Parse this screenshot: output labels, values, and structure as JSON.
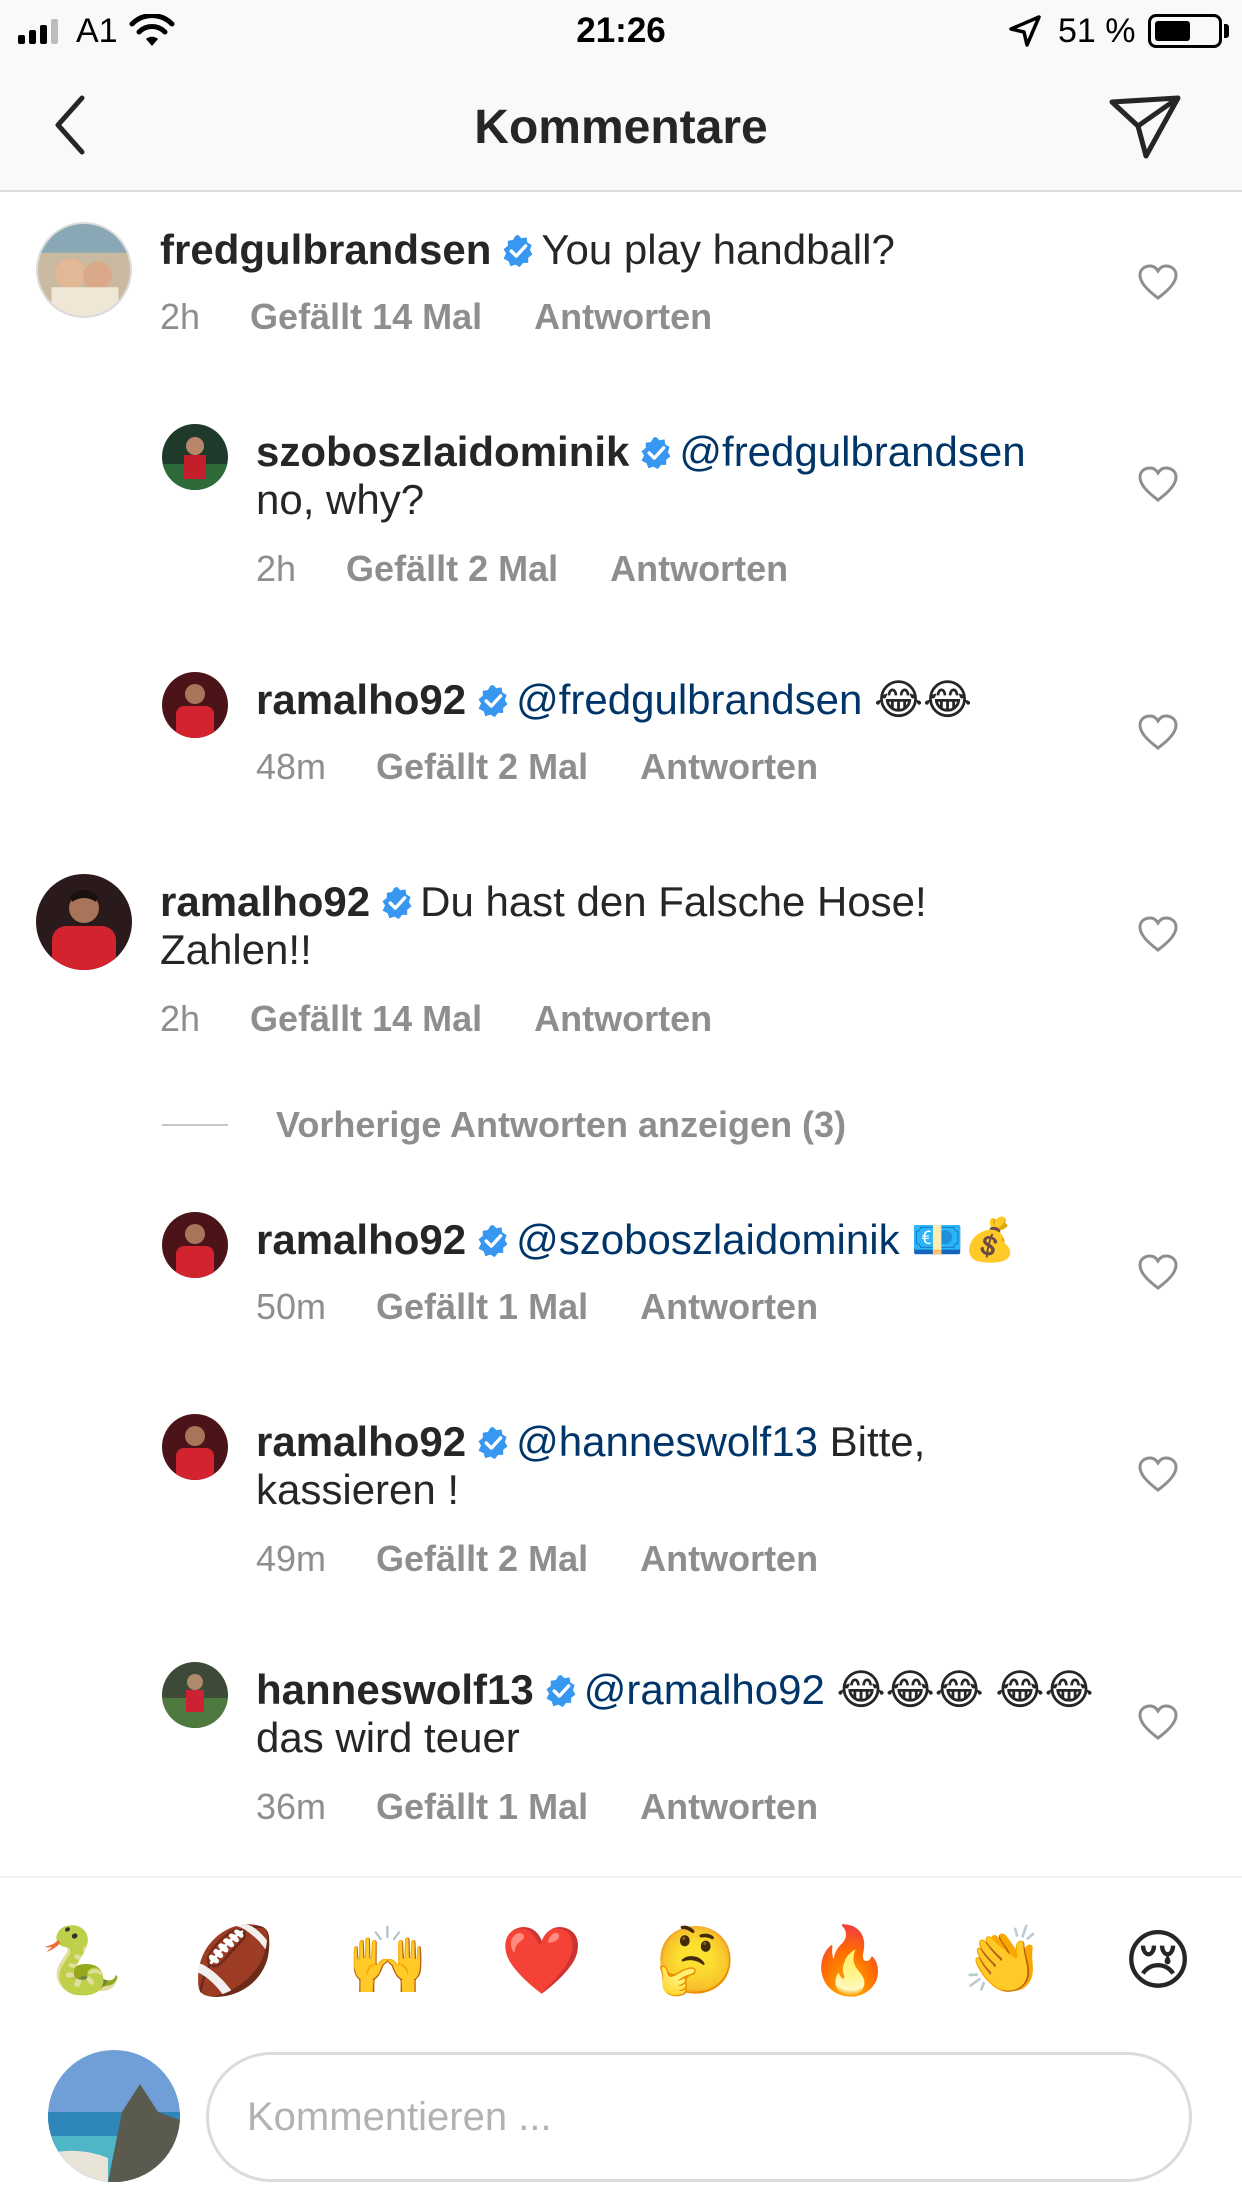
{
  "status_bar": {
    "carrier": "A1",
    "time": "21:26",
    "battery_percent": "51 %",
    "battery_level": 0.51,
    "signal_bars_filled": 3,
    "signal_bars_total": 4
  },
  "header": {
    "title": "Kommentare",
    "back_icon": "chevron-left-icon",
    "send_icon": "paper-plane-icon"
  },
  "comments": [
    {
      "username": "fredgulbrandsen",
      "verified": true,
      "mention": "",
      "text": "You play handball?",
      "time": "2h",
      "likes": "Gefällt 14 Mal",
      "reply": "Antworten",
      "indent": false
    },
    {
      "username": "szoboszlaidominik",
      "verified": true,
      "mention": "@fredgulbrandsen",
      "text": "no, why?",
      "time": "2h",
      "likes": "Gefällt 2 Mal",
      "reply": "Antworten",
      "indent": true
    },
    {
      "username": "ramalho92",
      "verified": true,
      "mention": "@fredgulbrandsen",
      "text": "😂😂",
      "time": "48m",
      "likes": "Gefällt 2 Mal",
      "reply": "Antworten",
      "indent": true
    },
    {
      "username": "ramalho92",
      "verified": true,
      "mention": "",
      "text": "Du hast den Falsche Hose! Zahlen!!",
      "time": "2h",
      "likes": "Gefällt 14 Mal",
      "reply": "Antworten",
      "indent": false
    },
    {
      "username": "ramalho92",
      "verified": true,
      "mention": "@szoboszlaidominik",
      "text": "💶💰",
      "time": "50m",
      "likes": "Gefällt 1 Mal",
      "reply": "Antworten",
      "indent": true
    },
    {
      "username": "ramalho92",
      "verified": true,
      "mention": "@hanneswolf13",
      "text": "Bitte, kassieren !",
      "time": "49m",
      "likes": "Gefällt 2 Mal",
      "reply": "Antworten",
      "indent": true
    },
    {
      "username": "hanneswolf13",
      "verified": true,
      "mention": "@ramalho92",
      "text": "😂😂😂 😂😂 das wird teuer",
      "time": "36m",
      "likes": "Gefällt 1 Mal",
      "reply": "Antworten",
      "indent": true
    }
  ],
  "view_previous": "Vorherige Antworten anzeigen (3)",
  "quick_emojis": [
    "🐍",
    "🏈",
    "🙌",
    "❤️",
    "🤔",
    "🔥",
    "👏",
    "😢"
  ],
  "composer": {
    "placeholder": "Kommentieren ..."
  },
  "colors": {
    "text": "#262626",
    "secondary": "#8e8e8e",
    "mention": "#003569",
    "verified": "#3897f0",
    "border": "#dbdbdb"
  }
}
